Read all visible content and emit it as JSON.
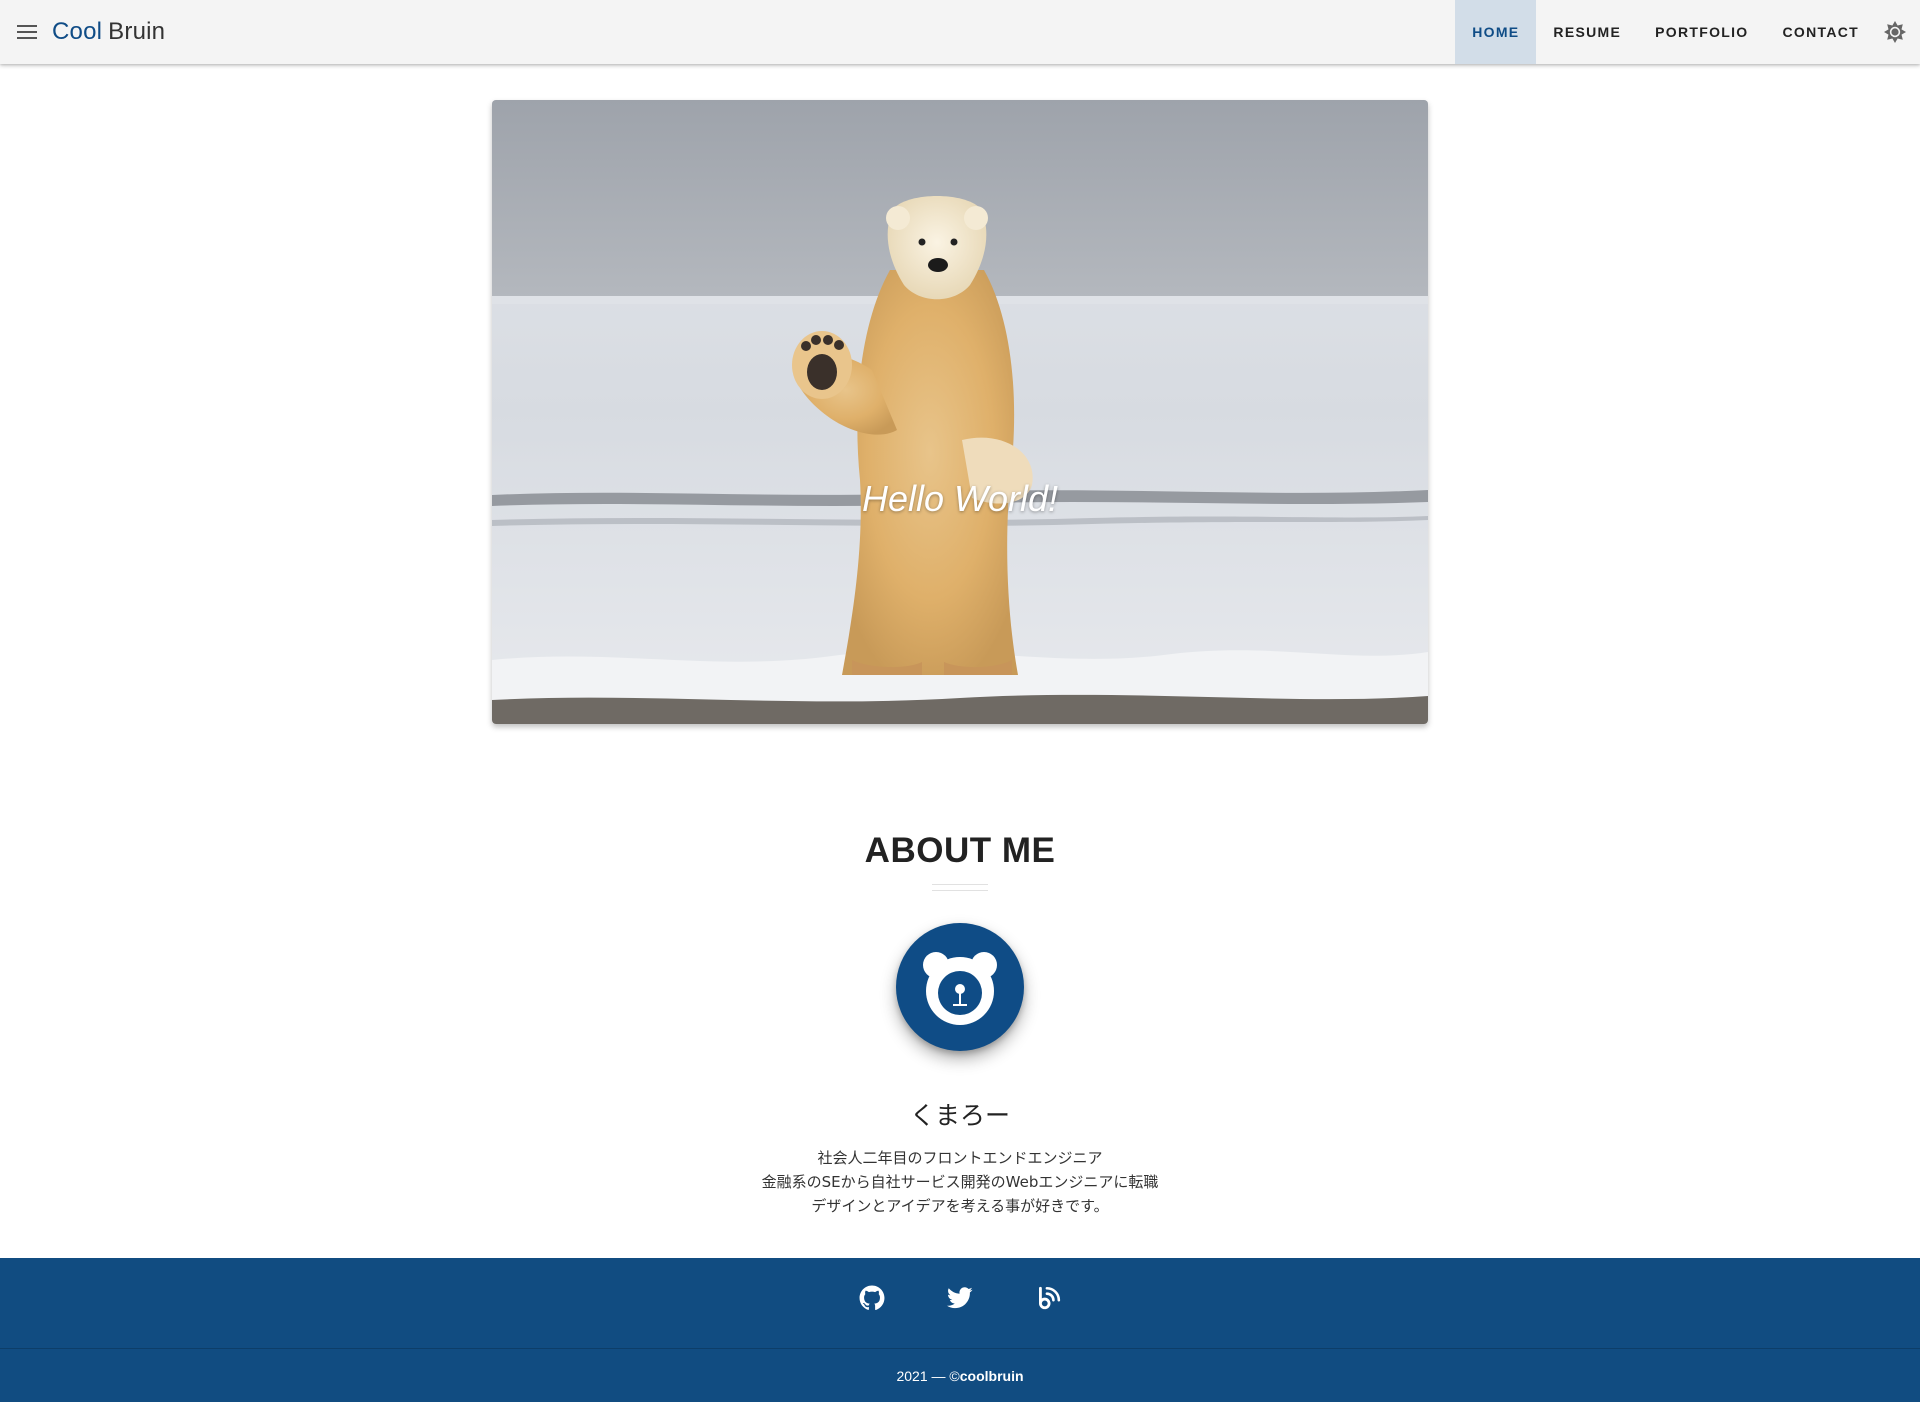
{
  "header": {
    "brand_primary": "Cool",
    "brand_secondary": "Bruin",
    "menu_icon": "hamburger-menu-icon",
    "theme_icon": "brightness-icon",
    "nav": [
      {
        "label": "HOME",
        "active": true
      },
      {
        "label": "RESUME",
        "active": false
      },
      {
        "label": "PORTFOLIO",
        "active": false
      },
      {
        "label": "CONTACT",
        "active": false
      }
    ]
  },
  "hero": {
    "headline": "Hello World!",
    "image": "polar-bear-waving-photo"
  },
  "about": {
    "title": "ABOUT ME",
    "avatar_icon": "bear-logo-icon",
    "name": "くまろー",
    "bio_lines": [
      "社会人二年目のフロントエンドエンジニア",
      "金融系のSEから自社サービス開発のWebエンジニアに転職",
      "デザインとアイデアを考える事が好きです。"
    ]
  },
  "footer": {
    "social_icons": [
      "github-icon",
      "twitter-icon",
      "blog-icon"
    ],
    "copyright_prefix": "2021 — ©",
    "copyright_owner": "coolbruin"
  },
  "colors": {
    "brand": "#0f4c86",
    "footer_bg": "#114c81",
    "appbar_bg": "#f4f4f4",
    "nav_active_bg": "#d2dde8"
  }
}
